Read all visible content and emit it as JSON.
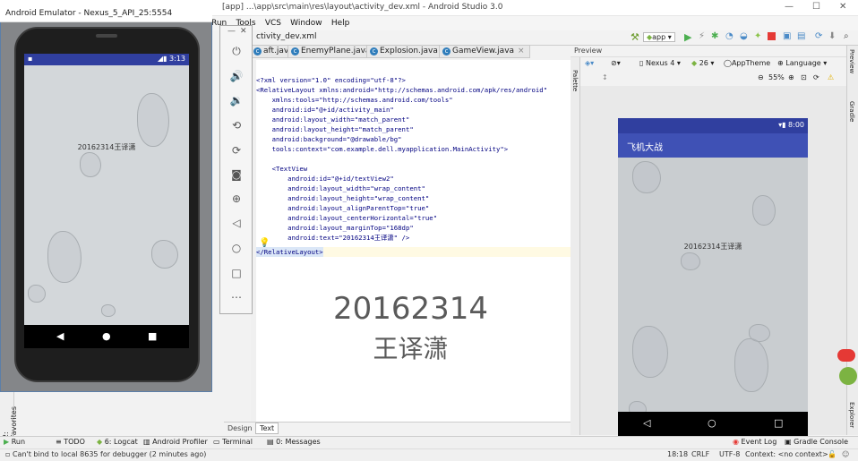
{
  "window": {
    "title": "...\\app\\src\\main\\res\\layout\\activity_dev.xml - Android Studio 3.0",
    "project_fragment": "[app]"
  },
  "menu": [
    "Run",
    "Tools",
    "VCS",
    "Window",
    "Help"
  ],
  "emulator": {
    "title": "Android Emulator - Nexus_5_API_25:5554",
    "status_time": "3:13",
    "screen_text": "20162314王译潇",
    "side_icons": [
      "power-icon",
      "volume-up-icon",
      "volume-down-icon",
      "rotate-left-icon",
      "rotate-right-icon",
      "camera-icon",
      "zoom-icon",
      "back-icon",
      "home-icon",
      "overview-icon",
      "more-icon"
    ]
  },
  "toolbar": {
    "run_config": "app"
  },
  "tabs": [
    {
      "label": "aft.java"
    },
    {
      "label": "EnemyPlane.java"
    },
    {
      "label": "Explosion.java"
    },
    {
      "label": "GameView.java"
    }
  ],
  "breadcrumb_file": "ctivity_dev.xml",
  "code": [
    "<?xml version=\"1.0\" encoding=\"utf-8\"?>",
    "<RelativeLayout xmlns:android=\"http://schemas.android.com/apk/res/android\"",
    "    xmlns:tools=\"http://schemas.android.com/tools\"",
    "    android:id=\"@+id/activity_main\"",
    "    android:layout_width=\"match_parent\"",
    "    android:layout_height=\"match_parent\"",
    "    android:background=\"@drawable/bg\"",
    "    tools:context=\"com.example.dell.myapplication.MainActivity\">",
    "",
    "    <TextView",
    "        android:id=\"@+id/textView2\"",
    "        android:layout_width=\"wrap_content\"",
    "        android:layout_height=\"wrap_content\"",
    "        android:layout_alignParentTop=\"true\"",
    "        android:layout_centerHorizontal=\"true\"",
    "        android:layout_marginTop=\"168dp\"",
    "        android:text=\"20162314王译潇\" />",
    "</RelativeLayout>"
  ],
  "preview_big_text": {
    "line1": "20162314",
    "line2": "王译潇"
  },
  "editor_tabs": {
    "design": "Design",
    "text": "Text"
  },
  "preview": {
    "label": "Preview",
    "device": "Nexus 4",
    "api": "26",
    "theme": "AppTheme",
    "language": "Language",
    "zoom": "55%",
    "status_time": "8:00",
    "app_title": "飞机大战",
    "screen_text": "20162314王译潇",
    "side_label": "Palette"
  },
  "right_strip": [
    "Preview",
    "Gradle",
    "Explorer"
  ],
  "left_strip": [
    "2: Favorites"
  ],
  "bottom_tools": [
    "Run",
    "TODO",
    "6: Logcat",
    "Android Profiler",
    "Terminal",
    "0: Messages",
    "Event Log",
    "Gradle Console"
  ],
  "status": {
    "message": "Can't bind to local 8635 for debugger (2 minutes ago)",
    "position": "18:18",
    "line_sep": "CRLF",
    "encoding": "UTF-8",
    "context": "Context: <no context>"
  },
  "colors": {
    "primary": "#3f51b5",
    "primary_dark": "#303f9f"
  }
}
